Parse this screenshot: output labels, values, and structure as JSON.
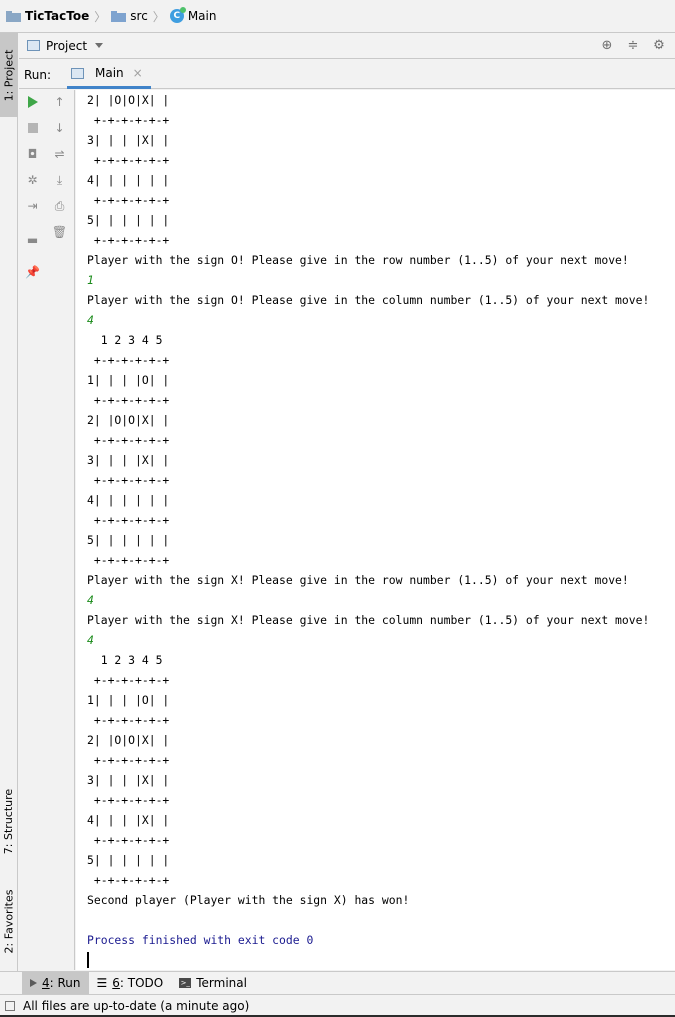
{
  "breadcrumb": {
    "project": "TicTacToe",
    "folder": "src",
    "file": "Main",
    "class_icon_letter": "C"
  },
  "left_strip": {
    "project_tab": "1: Project",
    "structure_tab": "7: Structure",
    "favorites_tab": "2: Favorites"
  },
  "project_panel": {
    "title": "Project"
  },
  "run_panel": {
    "label": "Run:",
    "tab": "Main"
  },
  "console": {
    "lines": [
      {
        "text": "2| |O|O|X| |",
        "kind": "out"
      },
      {
        "text": " +-+-+-+-+-+",
        "kind": "out"
      },
      {
        "text": "3| | | |X| |",
        "kind": "out"
      },
      {
        "text": " +-+-+-+-+-+",
        "kind": "out"
      },
      {
        "text": "4| | | | | |",
        "kind": "out"
      },
      {
        "text": " +-+-+-+-+-+",
        "kind": "out"
      },
      {
        "text": "5| | | | | |",
        "kind": "out"
      },
      {
        "text": " +-+-+-+-+-+",
        "kind": "out"
      },
      {
        "text": "Player with the sign O! Please give in the row number (1..5) of your next move!",
        "kind": "out"
      },
      {
        "text": "1",
        "kind": "input"
      },
      {
        "text": "Player with the sign O! Please give in the column number (1..5) of your next move!",
        "kind": "out"
      },
      {
        "text": "4",
        "kind": "input"
      },
      {
        "text": "  1 2 3 4 5",
        "kind": "out"
      },
      {
        "text": " +-+-+-+-+-+",
        "kind": "out"
      },
      {
        "text": "1| | | |O| |",
        "kind": "out"
      },
      {
        "text": " +-+-+-+-+-+",
        "kind": "out"
      },
      {
        "text": "2| |O|O|X| |",
        "kind": "out"
      },
      {
        "text": " +-+-+-+-+-+",
        "kind": "out"
      },
      {
        "text": "3| | | |X| |",
        "kind": "out"
      },
      {
        "text": " +-+-+-+-+-+",
        "kind": "out"
      },
      {
        "text": "4| | | | | |",
        "kind": "out"
      },
      {
        "text": " +-+-+-+-+-+",
        "kind": "out"
      },
      {
        "text": "5| | | | | |",
        "kind": "out"
      },
      {
        "text": " +-+-+-+-+-+",
        "kind": "out"
      },
      {
        "text": "Player with the sign X! Please give in the row number (1..5) of your next move!",
        "kind": "out"
      },
      {
        "text": "4",
        "kind": "input"
      },
      {
        "text": "Player with the sign X! Please give in the column number (1..5) of your next move!",
        "kind": "out"
      },
      {
        "text": "4",
        "kind": "input"
      },
      {
        "text": "  1 2 3 4 5",
        "kind": "out"
      },
      {
        "text": " +-+-+-+-+-+",
        "kind": "out"
      },
      {
        "text": "1| | | |O| |",
        "kind": "out"
      },
      {
        "text": " +-+-+-+-+-+",
        "kind": "out"
      },
      {
        "text": "2| |O|O|X| |",
        "kind": "out"
      },
      {
        "text": " +-+-+-+-+-+",
        "kind": "out"
      },
      {
        "text": "3| | | |X| |",
        "kind": "out"
      },
      {
        "text": " +-+-+-+-+-+",
        "kind": "out"
      },
      {
        "text": "4| | | |X| |",
        "kind": "out"
      },
      {
        "text": " +-+-+-+-+-+",
        "kind": "out"
      },
      {
        "text": "5| | | | | |",
        "kind": "out"
      },
      {
        "text": " +-+-+-+-+-+",
        "kind": "out"
      },
      {
        "text": "Second player (Player with the sign X) has won!",
        "kind": "out"
      },
      {
        "text": "",
        "kind": "out"
      },
      {
        "text": "Process finished with exit code 0",
        "kind": "process"
      }
    ]
  },
  "bottom_tabs": {
    "run_num": "4",
    "run_label": ": Run",
    "todo_num": "6",
    "todo_label": ": TODO",
    "terminal_label": "Terminal"
  },
  "status": {
    "text": "All files are up-to-date (a minute ago)"
  },
  "icons": {
    "crosshair": "crosshair-icon",
    "collapse": "collapse-icon",
    "settings": "gear-icon"
  },
  "colors": {
    "input_text": "#1a8a1a",
    "process_text": "#1a1a8f",
    "tab_underline": "#4083c9",
    "run_green": "#3fa648"
  }
}
